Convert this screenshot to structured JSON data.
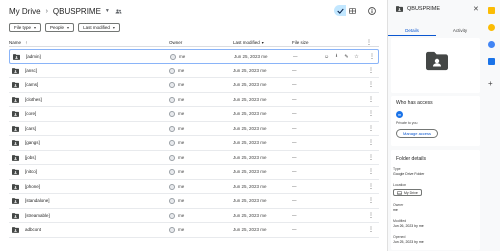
{
  "breadcrumb": {
    "root": "My Drive",
    "current": "QBUSPRIME"
  },
  "filters": [
    {
      "label": "File type"
    },
    {
      "label": "People"
    },
    {
      "label": "Last modified"
    }
  ],
  "table": {
    "headers": {
      "name": "Name",
      "owner": "Owner",
      "modified": "Last modified",
      "size": "File size"
    },
    "sort_arrow": "↑",
    "rows": [
      {
        "name": "[admin]",
        "owner": "me",
        "modified": "Jun 25, 2023 me",
        "size": "—"
      },
      {
        "name": "[ansc]",
        "owner": "me",
        "modified": "Jun 25, 2023 me",
        "size": "—"
      },
      {
        "name": "[cams]",
        "owner": "me",
        "modified": "Jun 25, 2023 me",
        "size": "—"
      },
      {
        "name": "[clothes]",
        "owner": "me",
        "modified": "Jun 25, 2023 me",
        "size": "—"
      },
      {
        "name": "[core]",
        "owner": "me",
        "modified": "Jun 25, 2023 me",
        "size": "—"
      },
      {
        "name": "[cars]",
        "owner": "me",
        "modified": "Jun 25, 2023 me",
        "size": "—"
      },
      {
        "name": "[gangs]",
        "owner": "me",
        "modified": "Jun 25, 2023 me",
        "size": "—"
      },
      {
        "name": "[jobs]",
        "owner": "me",
        "modified": "Jun 25, 2023 me",
        "size": "—"
      },
      {
        "name": "[nitco]",
        "owner": "me",
        "modified": "Jun 25, 2023 me",
        "size": "—"
      },
      {
        "name": "[phone]",
        "owner": "me",
        "modified": "Jun 25, 2023 me",
        "size": "—"
      },
      {
        "name": "[standalone]",
        "owner": "me",
        "modified": "Jun 25, 2023 me",
        "size": "—"
      },
      {
        "name": "[streamable]",
        "owner": "me",
        "modified": "Jun 25, 2023 me",
        "size": "—"
      },
      {
        "name": "adbcont",
        "owner": "me",
        "modified": "Jun 25, 2023 me",
        "size": "—"
      }
    ]
  },
  "details": {
    "title": "QBUSPRIME",
    "tabs": [
      "Details",
      "Activity"
    ],
    "who_has_access": "Who has access",
    "access_avatar_letter": "m",
    "access_note": "Private to you",
    "manage_access": "Manage access",
    "folder_details": "Folder details",
    "type_label": "Type",
    "type_value": "Google Drive Folder",
    "location_label": "Location",
    "location_value": "My Drive",
    "owner_label": "Owner",
    "owner_value": "me",
    "modified_label": "Modified",
    "modified_value": "Jun 26, 2023 by me",
    "opened_label": "Opened",
    "opened_value": "Jun 25, 2023 by me"
  },
  "colors": {
    "accent": "#0b57d0",
    "selected_toggle": "#c2e7ff",
    "folder": "#444746"
  }
}
